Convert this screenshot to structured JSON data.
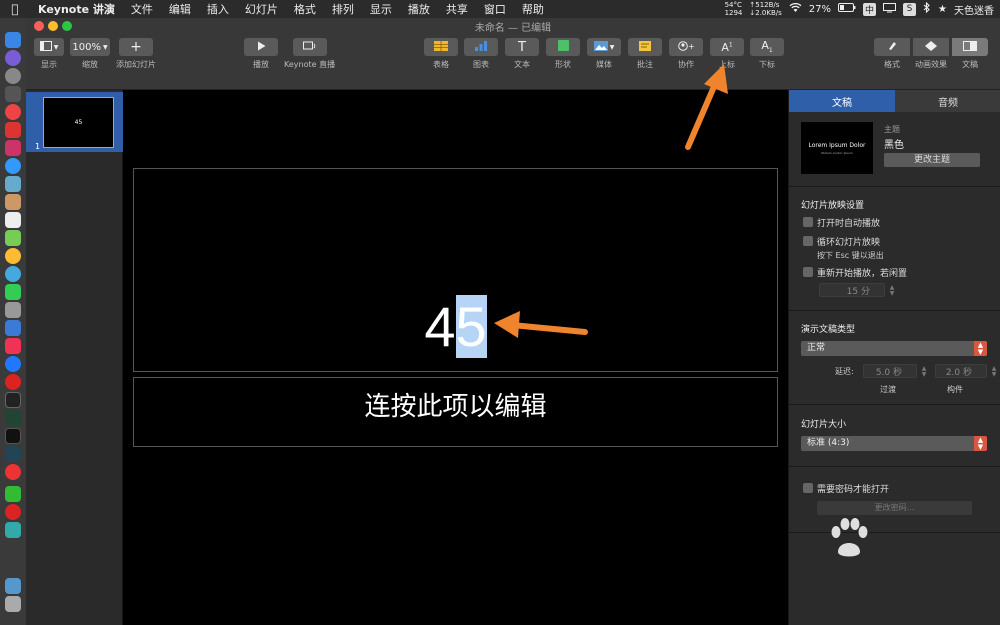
{
  "menubar": {
    "app_name": "Keynote 讲演",
    "items": [
      "文件",
      "编辑",
      "插入",
      "幻灯片",
      "格式",
      "排列",
      "显示",
      "播放",
      "共享",
      "窗口",
      "帮助"
    ],
    "temp": "54°C",
    "fan": "1294",
    "net_up": "↑512B/s",
    "net_down": "↓2.0KB/s",
    "battery": "27%",
    "input_method": "中",
    "user": "天色迷香"
  },
  "window": {
    "title": "未命名 — 已编辑"
  },
  "toolbar": {
    "view": "显示",
    "zoom_value": "100%",
    "zoom": "缩放",
    "add_slide": "添加幻灯片",
    "play": "播放",
    "keynote_live": "Keynote 直播",
    "table": "表格",
    "chart": "图表",
    "text": "文本",
    "shape": "形状",
    "media": "媒体",
    "comment": "批注",
    "collaborate": "协作",
    "superscript": "上标",
    "subscript": "下标",
    "format": "格式",
    "animate": "动画效果",
    "document": "文稿"
  },
  "navigator": {
    "slide_number": "1",
    "slide_thumb_text": "45"
  },
  "slide": {
    "title_normal": "4",
    "title_selected": "5",
    "body": "连按此项以编辑"
  },
  "inspector": {
    "tabs": [
      "文稿",
      "音频"
    ],
    "theme_label": "主题",
    "theme_name": "黑色",
    "theme_preview": "Lorem Ipsum Dolor",
    "theme_preview_sub": "Nullam Auctor Ipsum",
    "change_theme": "更改主题",
    "playback_title": "幻灯片放映设置",
    "autoplay": "打开时自动播放",
    "loop": "循环幻灯片放映",
    "loop_hint": "按下 Esc 键以退出",
    "restart": "重新开始播放，若闲置",
    "idle_minutes": "15 分",
    "presentation_type_title": "演示文稿类型",
    "presentation_type": "正常",
    "delay_label": "延迟:",
    "delay_transition": "5.0 秒",
    "delay_build": "2.0 秒",
    "transition_label": "过渡",
    "build_label": "构件",
    "slide_size_title": "幻灯片大小",
    "slide_size": "标准 (4:3)",
    "password_required": "需要密码才能打开",
    "change_password": "更改密码..."
  },
  "colors": {
    "accent": "#2f5fa8",
    "selection": "#b6d4f5",
    "select_handle": "#d9573f",
    "arrow": "#f0842c"
  }
}
